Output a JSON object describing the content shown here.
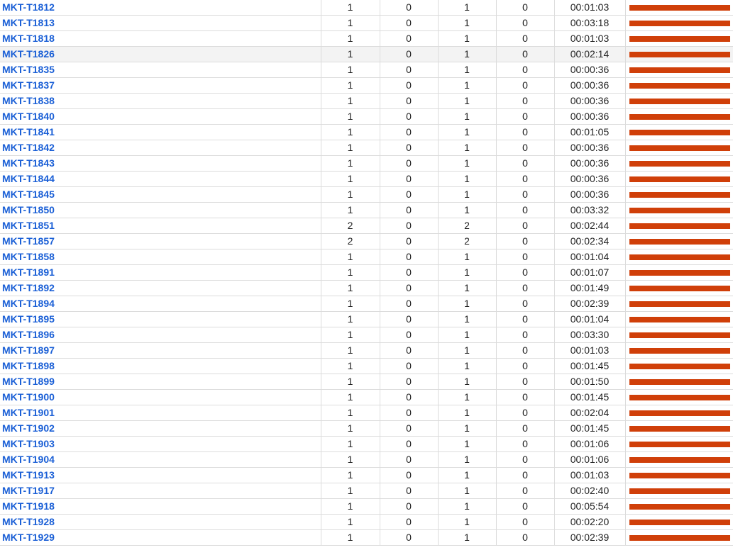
{
  "colors": {
    "link": "#1a5fd6",
    "bar": "#d03f09",
    "grid_line": "#dcdcdc"
  },
  "rows": [
    {
      "key": "MKT-T1812",
      "c1": "1",
      "c2": "0",
      "c3": "1",
      "c4": "0",
      "time": "00:01:03",
      "bar": 1.0
    },
    {
      "key": "MKT-T1813",
      "c1": "1",
      "c2": "0",
      "c3": "1",
      "c4": "0",
      "time": "00:03:18",
      "bar": 1.0
    },
    {
      "key": "MKT-T1818",
      "c1": "1",
      "c2": "0",
      "c3": "1",
      "c4": "0",
      "time": "00:01:03",
      "bar": 1.0
    },
    {
      "key": "MKT-T1826",
      "c1": "1",
      "c2": "0",
      "c3": "1",
      "c4": "0",
      "time": "00:02:14",
      "bar": 1.0,
      "highlighted": true
    },
    {
      "key": "MKT-T1835",
      "c1": "1",
      "c2": "0",
      "c3": "1",
      "c4": "0",
      "time": "00:00:36",
      "bar": 1.0
    },
    {
      "key": "MKT-T1837",
      "c1": "1",
      "c2": "0",
      "c3": "1",
      "c4": "0",
      "time": "00:00:36",
      "bar": 1.0
    },
    {
      "key": "MKT-T1838",
      "c1": "1",
      "c2": "0",
      "c3": "1",
      "c4": "0",
      "time": "00:00:36",
      "bar": 1.0
    },
    {
      "key": "MKT-T1840",
      "c1": "1",
      "c2": "0",
      "c3": "1",
      "c4": "0",
      "time": "00:00:36",
      "bar": 1.0
    },
    {
      "key": "MKT-T1841",
      "c1": "1",
      "c2": "0",
      "c3": "1",
      "c4": "0",
      "time": "00:01:05",
      "bar": 1.0
    },
    {
      "key": "MKT-T1842",
      "c1": "1",
      "c2": "0",
      "c3": "1",
      "c4": "0",
      "time": "00:00:36",
      "bar": 1.0
    },
    {
      "key": "MKT-T1843",
      "c1": "1",
      "c2": "0",
      "c3": "1",
      "c4": "0",
      "time": "00:00:36",
      "bar": 1.0
    },
    {
      "key": "MKT-T1844",
      "c1": "1",
      "c2": "0",
      "c3": "1",
      "c4": "0",
      "time": "00:00:36",
      "bar": 1.0
    },
    {
      "key": "MKT-T1845",
      "c1": "1",
      "c2": "0",
      "c3": "1",
      "c4": "0",
      "time": "00:00:36",
      "bar": 1.0
    },
    {
      "key": "MKT-T1850",
      "c1": "1",
      "c2": "0",
      "c3": "1",
      "c4": "0",
      "time": "00:03:32",
      "bar": 1.0
    },
    {
      "key": "MKT-T1851",
      "c1": "2",
      "c2": "0",
      "c3": "2",
      "c4": "0",
      "time": "00:02:44",
      "bar": 1.0
    },
    {
      "key": "MKT-T1857",
      "c1": "2",
      "c2": "0",
      "c3": "2",
      "c4": "0",
      "time": "00:02:34",
      "bar": 1.0
    },
    {
      "key": "MKT-T1858",
      "c1": "1",
      "c2": "0",
      "c3": "1",
      "c4": "0",
      "time": "00:01:04",
      "bar": 1.0
    },
    {
      "key": "MKT-T1891",
      "c1": "1",
      "c2": "0",
      "c3": "1",
      "c4": "0",
      "time": "00:01:07",
      "bar": 1.0
    },
    {
      "key": "MKT-T1892",
      "c1": "1",
      "c2": "0",
      "c3": "1",
      "c4": "0",
      "time": "00:01:49",
      "bar": 1.0
    },
    {
      "key": "MKT-T1894",
      "c1": "1",
      "c2": "0",
      "c3": "1",
      "c4": "0",
      "time": "00:02:39",
      "bar": 1.0
    },
    {
      "key": "MKT-T1895",
      "c1": "1",
      "c2": "0",
      "c3": "1",
      "c4": "0",
      "time": "00:01:04",
      "bar": 1.0
    },
    {
      "key": "MKT-T1896",
      "c1": "1",
      "c2": "0",
      "c3": "1",
      "c4": "0",
      "time": "00:03:30",
      "bar": 1.0
    },
    {
      "key": "MKT-T1897",
      "c1": "1",
      "c2": "0",
      "c3": "1",
      "c4": "0",
      "time": "00:01:03",
      "bar": 1.0
    },
    {
      "key": "MKT-T1898",
      "c1": "1",
      "c2": "0",
      "c3": "1",
      "c4": "0",
      "time": "00:01:45",
      "bar": 1.0
    },
    {
      "key": "MKT-T1899",
      "c1": "1",
      "c2": "0",
      "c3": "1",
      "c4": "0",
      "time": "00:01:50",
      "bar": 1.0
    },
    {
      "key": "MKT-T1900",
      "c1": "1",
      "c2": "0",
      "c3": "1",
      "c4": "0",
      "time": "00:01:45",
      "bar": 1.0
    },
    {
      "key": "MKT-T1901",
      "c1": "1",
      "c2": "0",
      "c3": "1",
      "c4": "0",
      "time": "00:02:04",
      "bar": 1.0
    },
    {
      "key": "MKT-T1902",
      "c1": "1",
      "c2": "0",
      "c3": "1",
      "c4": "0",
      "time": "00:01:45",
      "bar": 1.0
    },
    {
      "key": "MKT-T1903",
      "c1": "1",
      "c2": "0",
      "c3": "1",
      "c4": "0",
      "time": "00:01:06",
      "bar": 1.0
    },
    {
      "key": "MKT-T1904",
      "c1": "1",
      "c2": "0",
      "c3": "1",
      "c4": "0",
      "time": "00:01:06",
      "bar": 1.0
    },
    {
      "key": "MKT-T1913",
      "c1": "1",
      "c2": "0",
      "c3": "1",
      "c4": "0",
      "time": "00:01:03",
      "bar": 1.0
    },
    {
      "key": "MKT-T1917",
      "c1": "1",
      "c2": "0",
      "c3": "1",
      "c4": "0",
      "time": "00:02:40",
      "bar": 1.0
    },
    {
      "key": "MKT-T1918",
      "c1": "1",
      "c2": "0",
      "c3": "1",
      "c4": "0",
      "time": "00:05:54",
      "bar": 1.0
    },
    {
      "key": "MKT-T1928",
      "c1": "1",
      "c2": "0",
      "c3": "1",
      "c4": "0",
      "time": "00:02:20",
      "bar": 1.0
    },
    {
      "key": "MKT-T1929",
      "c1": "1",
      "c2": "0",
      "c3": "1",
      "c4": "0",
      "time": "00:02:39",
      "bar": 1.0
    }
  ]
}
